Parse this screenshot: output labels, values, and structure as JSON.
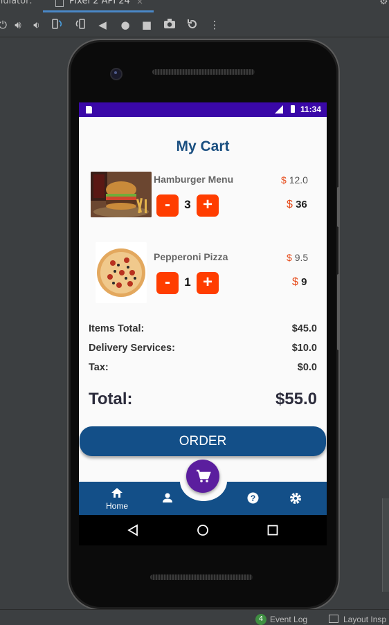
{
  "ide": {
    "title": "nulator:",
    "tab_label": "Pixel 2 API 24",
    "tab_close": "×",
    "status": {
      "event_badge": "4",
      "event_log": "Event Log",
      "layout_inspector": "Layout Insp"
    },
    "toolbar_icons": [
      "power-icon",
      "volume-up-icon",
      "volume-down-icon",
      "rotate-left-icon",
      "rotate-right-icon",
      "back-icon",
      "home-icon",
      "overview-icon",
      "camera-icon",
      "replay-icon",
      "more-icon"
    ]
  },
  "device": {
    "status_time": "11:34"
  },
  "cart": {
    "title": "My Cart",
    "currency": "$",
    "items": [
      {
        "name": "Hamburger Menu",
        "unit_price": "12.0",
        "quantity": "3",
        "line_total": "36",
        "minus": "-",
        "plus": "+"
      },
      {
        "name": "Pepperoni Pizza",
        "unit_price": "9.5",
        "quantity": "1",
        "line_total": "9",
        "minus": "-",
        "plus": "+"
      }
    ],
    "summary": {
      "items_total_label": "Items Total:",
      "items_total": "$45.0",
      "delivery_label": "Delivery Services:",
      "delivery": "$10.0",
      "tax_label": "Tax:",
      "tax": "$0.0",
      "total_label": "Total:",
      "total": "$55.0"
    },
    "order_label": "ORDER"
  },
  "bottom_nav": {
    "home_label": "Home",
    "items": [
      "home-icon",
      "person-icon",
      "cart-icon",
      "help-icon",
      "settings-icon"
    ]
  },
  "colors": {
    "primary": "#134f88",
    "accent": "#ff3d00",
    "status_bar": "#3a08a8",
    "fab": "#5b1e9e"
  }
}
